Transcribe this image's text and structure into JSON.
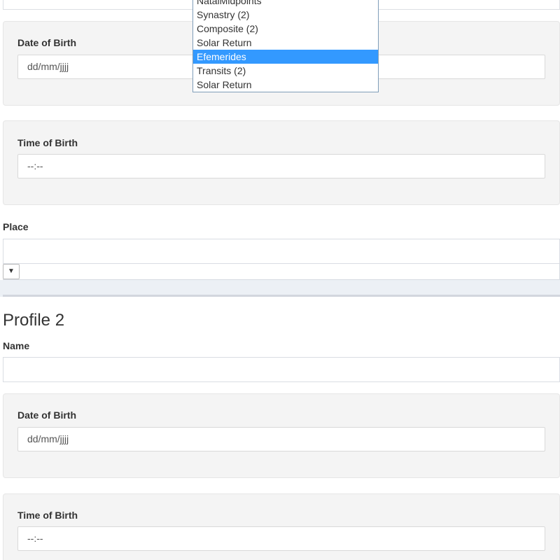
{
  "profile1": {
    "date_of_birth_label": "Date of Birth",
    "date_of_birth_placeholder": "dd/mm/jjjj",
    "time_of_birth_label": "Time of Birth",
    "time_of_birth_placeholder": "--:--",
    "place_label": "Place",
    "place_value": "",
    "select_arrow": "▼"
  },
  "profile2": {
    "title": "Profile 2",
    "name_label": "Name",
    "name_value": "",
    "date_of_birth_label": "Date of Birth",
    "date_of_birth_placeholder": "dd/mm/jjjj",
    "time_of_birth_label": "Time of Birth",
    "time_of_birth_placeholder": "--:--"
  },
  "chart_type_dropdown": {
    "items": [
      {
        "label": "NatalMidpoints",
        "selected": false
      },
      {
        "label": "Synastry (2)",
        "selected": false
      },
      {
        "label": "Composite (2)",
        "selected": false
      },
      {
        "label": "Solar Return",
        "selected": false
      },
      {
        "label": "Efemerides",
        "selected": true
      },
      {
        "label": "Transits (2)",
        "selected": false
      },
      {
        "label": "Solar Return",
        "selected": false
      }
    ]
  },
  "colors": {
    "selected_item_bg": "#3399ff",
    "panel_bg": "#f4f4f4",
    "separator_bg": "#ecf0f5"
  }
}
